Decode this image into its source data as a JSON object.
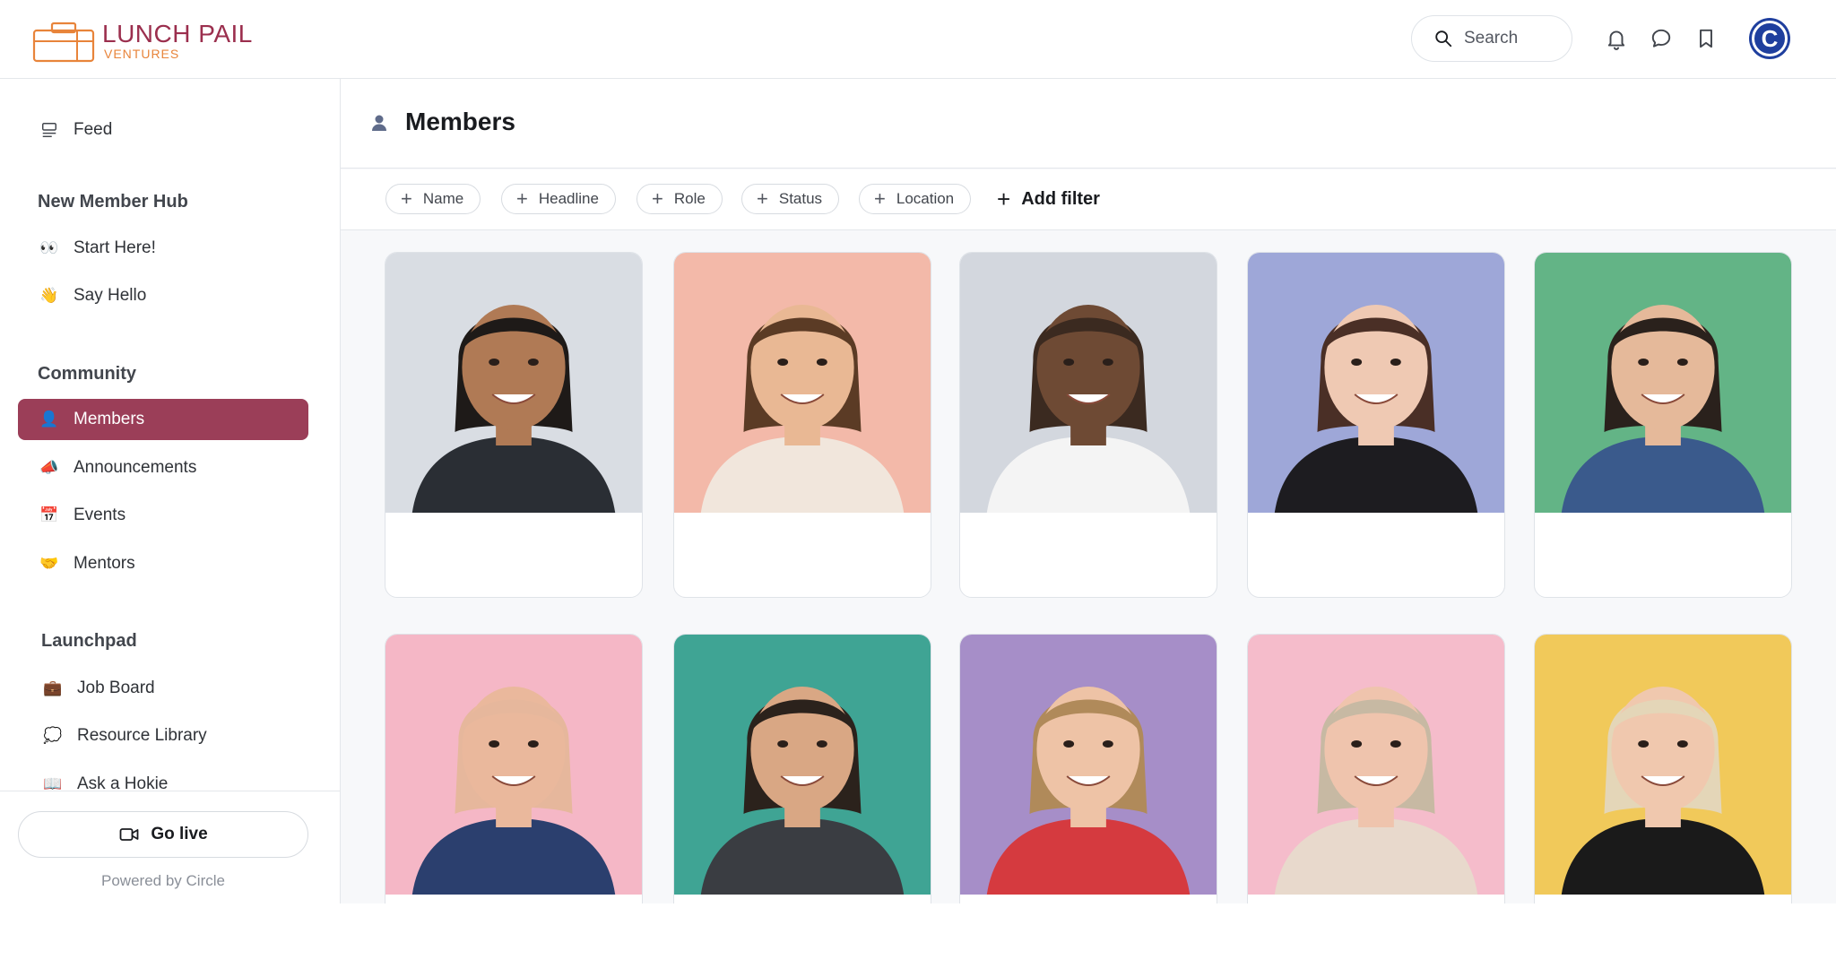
{
  "brand": {
    "name": "LUNCH PAIL",
    "sub": "VENTURES",
    "primary": "#9b2f4e",
    "accent": "#e8843a"
  },
  "header": {
    "search_label": "Search",
    "icons": [
      "bell-icon",
      "chat-icon",
      "bookmark-icon"
    ],
    "avatar_letter": "C"
  },
  "sidebar": {
    "feed": {
      "label": "Feed",
      "icon": "feed-icon"
    },
    "sections": [
      {
        "title": "New Member Hub",
        "items": [
          {
            "label": "Start Here!",
            "icon": "👀"
          },
          {
            "label": "Say Hello",
            "icon": "👋"
          }
        ]
      },
      {
        "title": "Community",
        "items": [
          {
            "label": "Members",
            "icon": "👤",
            "active": true
          },
          {
            "label": "Announcements",
            "icon": "📣"
          },
          {
            "label": "Events",
            "icon": "📅"
          },
          {
            "label": "Mentors",
            "icon": "🤝"
          }
        ]
      },
      {
        "title": "Launchpad",
        "items": [
          {
            "label": "Job Board",
            "icon": "💼"
          },
          {
            "label": "Resource Library",
            "icon": "💭"
          },
          {
            "label": "Ask a Hokie",
            "icon": "📖"
          }
        ]
      }
    ],
    "go_live": "Go live",
    "powered_by": "Powered by Circle",
    "active_color": "#9b3e58"
  },
  "main": {
    "title": "Members",
    "filters": [
      "Name",
      "Headline",
      "Role",
      "Status",
      "Location"
    ],
    "add_filter": "Add filter",
    "members": [
      {
        "bg": "#d9dde3",
        "skin": "#b07a55",
        "hair": "#1e1a18",
        "shirt": "#2a2e34"
      },
      {
        "bg": "#f3b9a9",
        "skin": "#e9b894",
        "hair": "#5b3b25",
        "shirt": "#f1e6dc"
      },
      {
        "bg": "#d3d7de",
        "skin": "#6e4a34",
        "hair": "#3b2a20",
        "shirt": "#f4f4f4"
      },
      {
        "bg": "#9ea7d8",
        "skin": "#efc9b3",
        "hair": "#4a2f26",
        "shirt": "#1d1c20"
      },
      {
        "bg": "#63b486",
        "skin": "#e5b99a",
        "hair": "#2a211c",
        "shirt": "#3a5a8c"
      },
      {
        "bg": "#f5b7c6",
        "skin": "#eab89c",
        "hair": "#e6b79c",
        "shirt": "#2b3f6e"
      },
      {
        "bg": "#3fa494",
        "skin": "#d9a784",
        "hair": "#2b221c",
        "shirt": "#3a3d42"
      },
      {
        "bg": "#a68ec8",
        "skin": "#eec3a6",
        "hair": "#b08a5a",
        "shirt": "#d53a3f"
      },
      {
        "bg": "#f5bccb",
        "skin": "#efc4ad",
        "hair": "#c7b9a3",
        "shirt": "#e8d9cc"
      },
      {
        "bg": "#f1c95a",
        "skin": "#f0c8ae",
        "hair": "#e4d6b8",
        "shirt": "#1a1a1a"
      }
    ]
  }
}
